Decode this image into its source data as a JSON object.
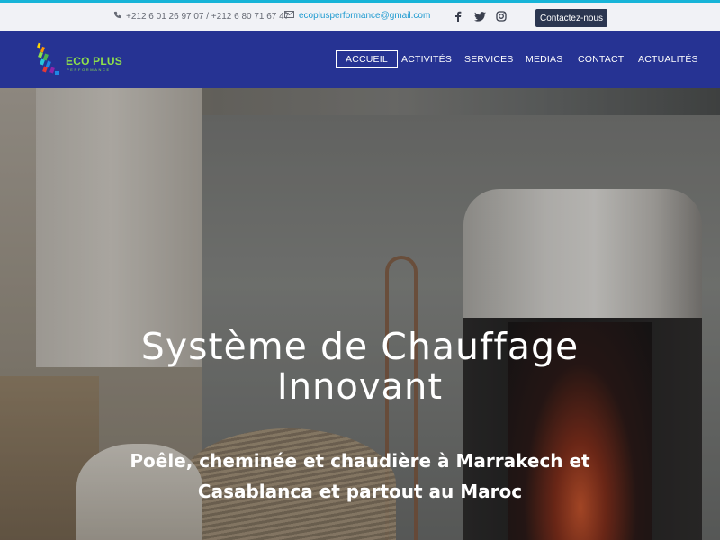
{
  "topbar": {
    "phone": "+212 6 01 26 97 07 / +212 6 80 71 67 47",
    "email": "ecoplusperformance@gmail.com",
    "socials": [
      "facebook-icon",
      "twitter-icon",
      "instagram-icon"
    ],
    "cta_label": "Contactez-nous"
  },
  "header": {
    "logo": {
      "brand": "ECO PLUS",
      "sub": "PERFORMANCE"
    },
    "nav": [
      {
        "label": "ACCUEIL",
        "active": true
      },
      {
        "label": "ACTIVITÉS",
        "active": false
      },
      {
        "label": "SERVICES",
        "active": false
      },
      {
        "label": "MEDIAS",
        "active": false
      },
      {
        "label": "CONTACT",
        "active": false
      },
      {
        "label": "ACTUALITÉS",
        "active": false
      }
    ]
  },
  "hero": {
    "title_line1": "Système de Chauffage",
    "title_line2": "Innovant",
    "subtitle_line1": "Poêle, cheminée et chaudière à Marrakech et",
    "subtitle_line2": "Casablanca et partout au Maroc"
  },
  "colors": {
    "accent": "#17b4d8",
    "topbar_bg": "#f1f2f6",
    "header_bg": "#263393",
    "cta_bg": "#2b3650",
    "logo_green": "#8ee04b"
  }
}
